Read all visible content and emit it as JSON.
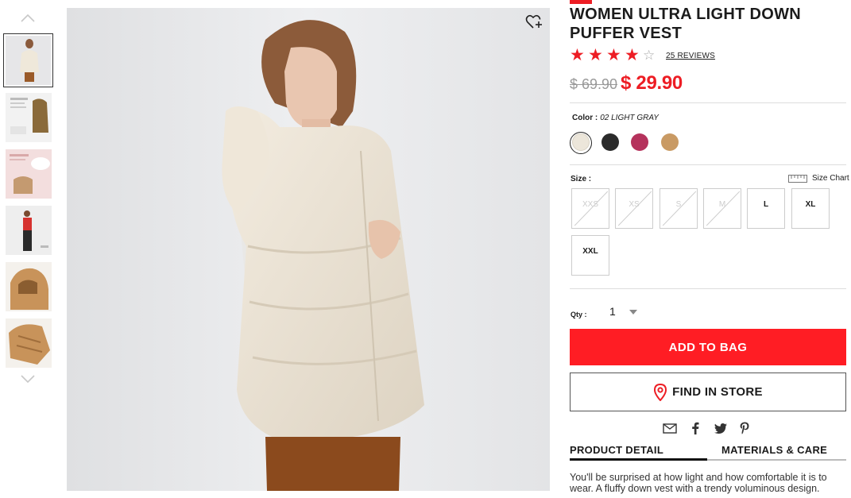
{
  "product": {
    "title": "WOMEN ULTRA LIGHT DOWN PUFFER VEST",
    "rating": 4.5,
    "rating_max": 5,
    "reviews_label": "25 REVIEWS",
    "price_original": "$ 69.90",
    "price_sale": "$ 29.90",
    "description": "You'll be surprised at how light and how comfortable it is to wear. A fluffy down vest with a trendy voluminous design."
  },
  "color": {
    "label": "Color :",
    "selected": "02 LIGHT GRAY",
    "swatches": [
      {
        "name": "light-gray",
        "hex": "#ece6da"
      },
      {
        "name": "black",
        "hex": "#2b2b2b"
      },
      {
        "name": "wine",
        "hex": "#b5325c"
      },
      {
        "name": "camel",
        "hex": "#c99a64"
      }
    ]
  },
  "size": {
    "label": "Size :",
    "chart_label": "Size Chart",
    "options": [
      {
        "label": "XXS",
        "available": false
      },
      {
        "label": "XS",
        "available": false
      },
      {
        "label": "S",
        "available": false
      },
      {
        "label": "M",
        "available": false
      },
      {
        "label": "L",
        "available": true
      },
      {
        "label": "XL",
        "available": true
      },
      {
        "label": "XXL",
        "available": true
      }
    ]
  },
  "quantity": {
    "label": "Qty :",
    "value": "1"
  },
  "buttons": {
    "add_to_bag": "ADD TO BAG",
    "find_in_store": "FIND IN STORE"
  },
  "share_icons": [
    "email-icon",
    "facebook-icon",
    "twitter-icon",
    "pinterest-icon"
  ],
  "tabs": {
    "product_detail": "PRODUCT DETAIL",
    "materials_care": "MATERIALS & CARE"
  },
  "colors": {
    "accent_red": "#ff1d24",
    "thumb_bg": "#e9e9eb"
  }
}
